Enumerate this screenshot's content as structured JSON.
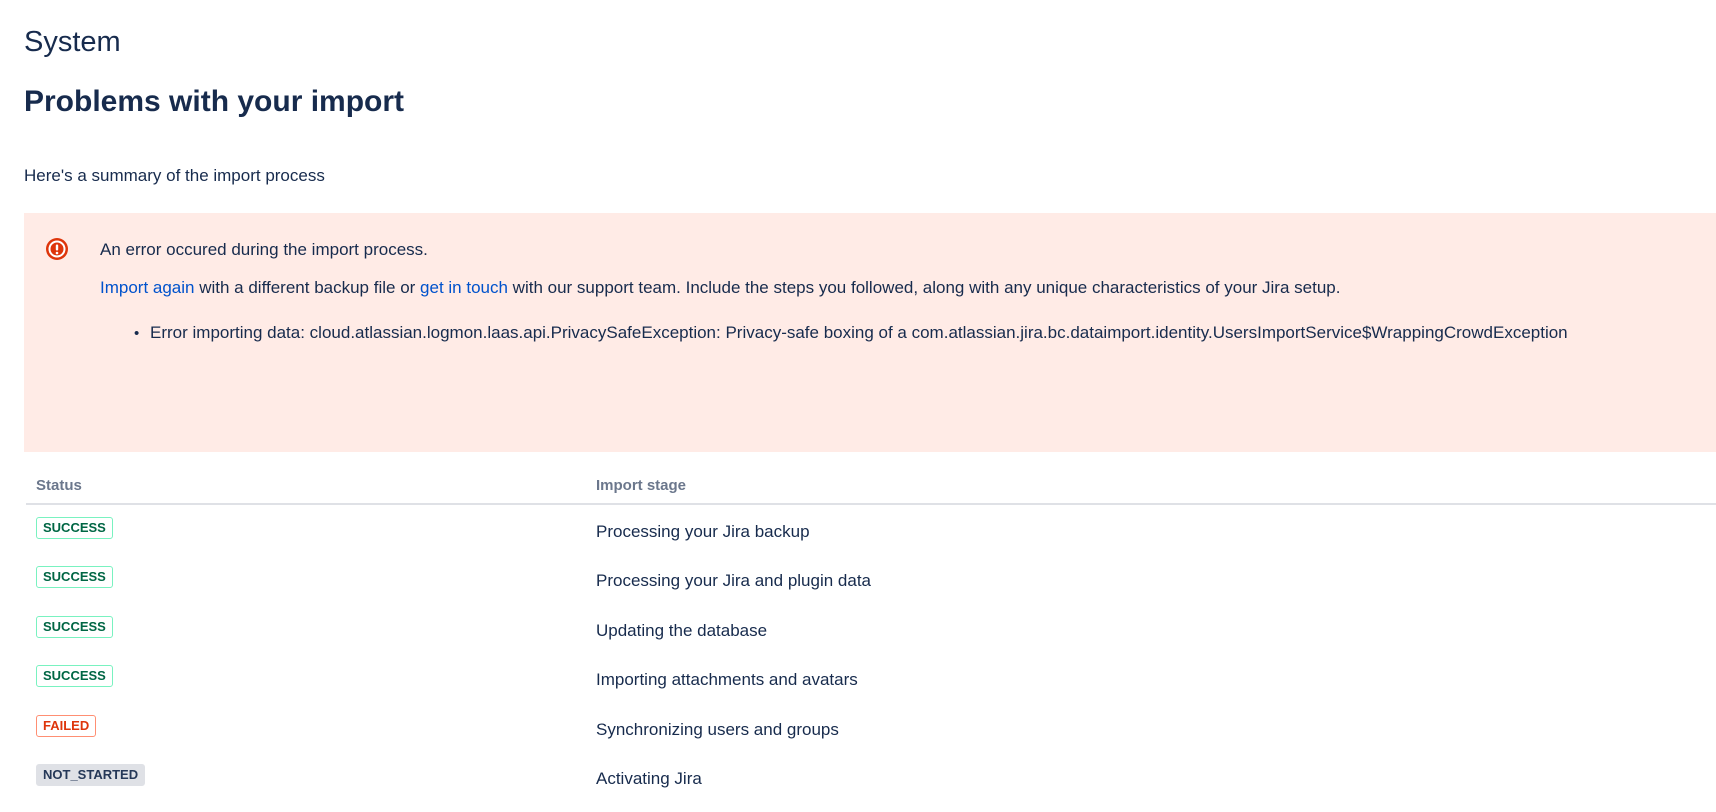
{
  "header": {
    "breadcrumb": "System",
    "title": "Problems with your import"
  },
  "summary": "Here's a summary of the import process",
  "error": {
    "heading": "An error occured during the import process.",
    "body": {
      "link_import_again": "Import again",
      "text_1": " with a different backup file or ",
      "link_get_in_touch": "get in touch",
      "text_2": " with our support team. Include the steps you followed, along with any unique characteristics of your Jira setup."
    },
    "details": [
      "Error importing data: cloud.atlassian.logmon.laas.api.PrivacySafeException: Privacy-safe boxing of a com.atlassian.jira.bc.dataimport.identity.UsersImportService$WrappingCrowdException"
    ],
    "icon": "error-icon",
    "colors": {
      "background": "#ffebe6",
      "icon": "#de350b",
      "link": "#0052cc"
    }
  },
  "table": {
    "headers": {
      "status": "Status",
      "stage": "Import stage"
    },
    "rows": [
      {
        "status": "SUCCESS",
        "status_type": "success",
        "stage": "Processing your Jira backup"
      },
      {
        "status": "SUCCESS",
        "status_type": "success",
        "stage": "Processing your Jira and plugin data"
      },
      {
        "status": "SUCCESS",
        "status_type": "success",
        "stage": "Updating the database"
      },
      {
        "status": "SUCCESS",
        "status_type": "success",
        "stage": "Importing attachments and avatars"
      },
      {
        "status": "FAILED",
        "status_type": "failed",
        "stage": "Synchronizing users and groups"
      },
      {
        "status": "NOT_STARTED",
        "status_type": "not-started",
        "stage": "Activating Jira"
      }
    ]
  }
}
